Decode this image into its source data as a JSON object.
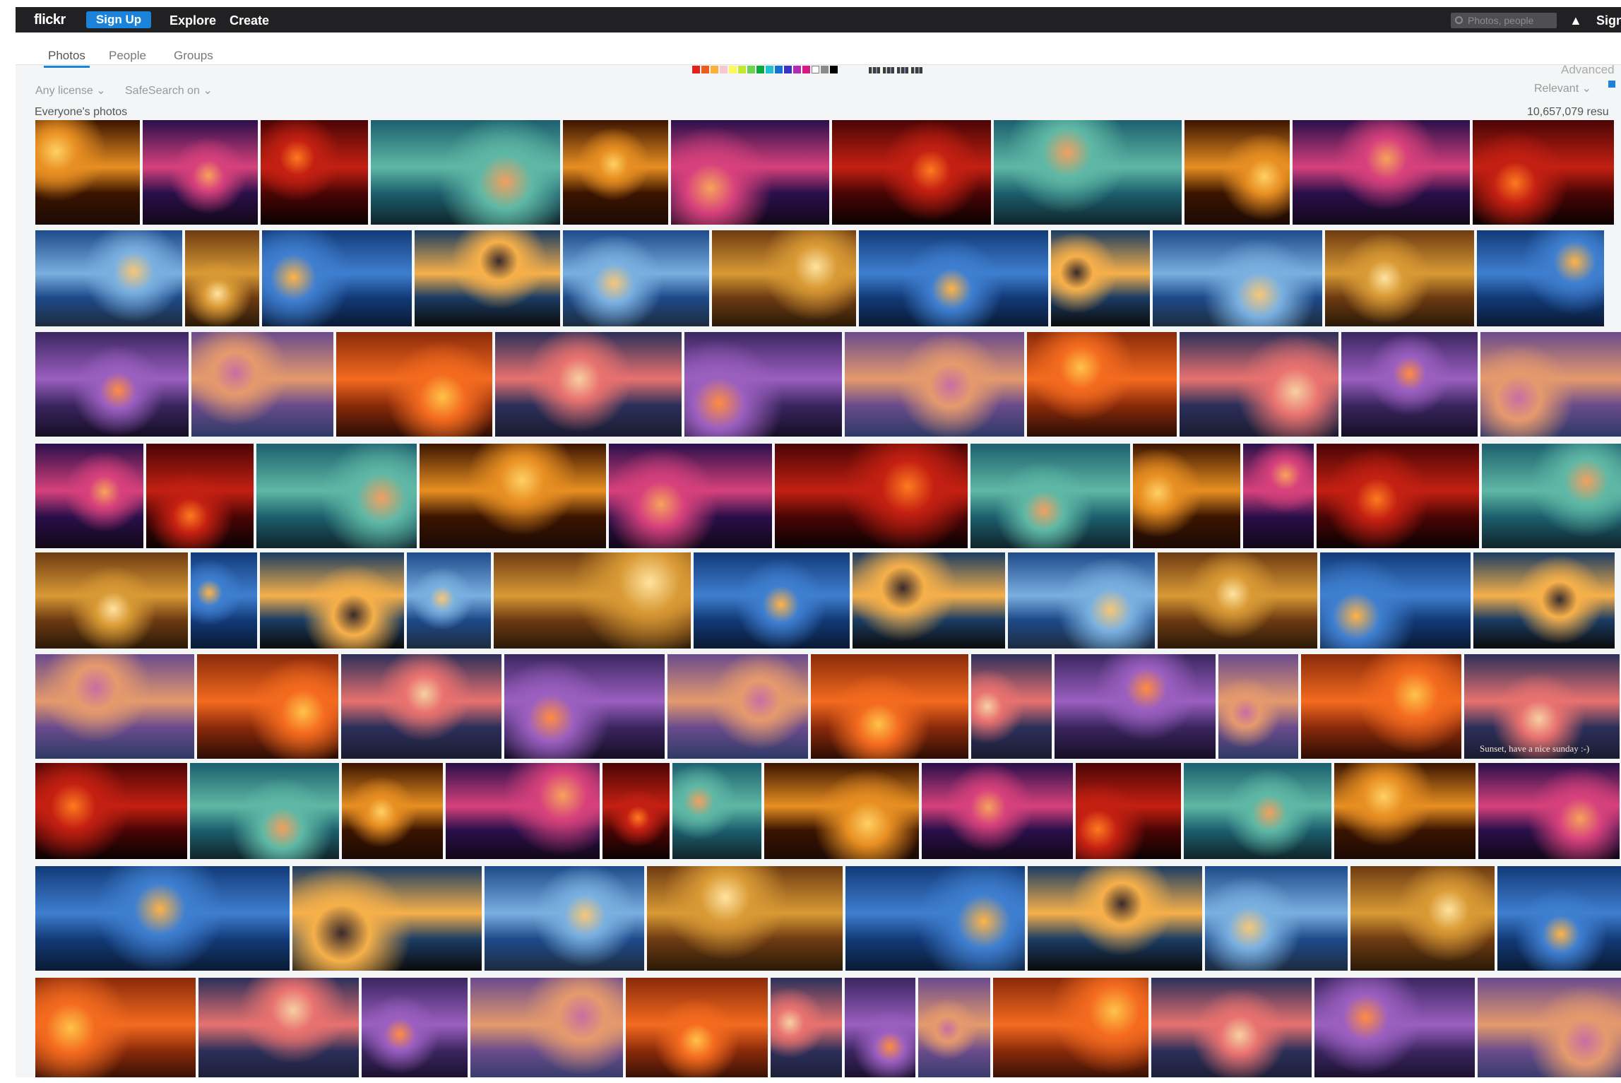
{
  "header": {
    "logo": "flickr",
    "signup_label": "Sign Up",
    "nav": [
      "Explore",
      "Create"
    ],
    "search_placeholder": "Photos, people",
    "signin_label": "Sign"
  },
  "tabs": {
    "photos": "Photos",
    "people": "People",
    "groups": "Groups"
  },
  "color_filters": [
    "#e2211c",
    "#f05b1b",
    "#fbb03b",
    "#f8c8cf",
    "#fdf85b",
    "#c4e82e",
    "#6fd34f",
    "#0aa843",
    "#1fc2d2",
    "#1272d6",
    "#3a34c4",
    "#b12ab8",
    "#d51b83",
    "#ffffff",
    "#8b8b8b",
    "#000000"
  ],
  "style_filters": [
    "depth-of-field-style-icon",
    "minimalist-style-icon",
    "black-white-style-icon",
    "pattern-style-icon"
  ],
  "advanced_label": "Advanced",
  "filters": {
    "license": "Any license",
    "safesearch": "SafeSearch on",
    "sort": "Relevant"
  },
  "section_heading": "Everyone's photos",
  "result_count": "10,657,079 resu",
  "photo_caption": "Sunset, have a nice sunday :-)"
}
